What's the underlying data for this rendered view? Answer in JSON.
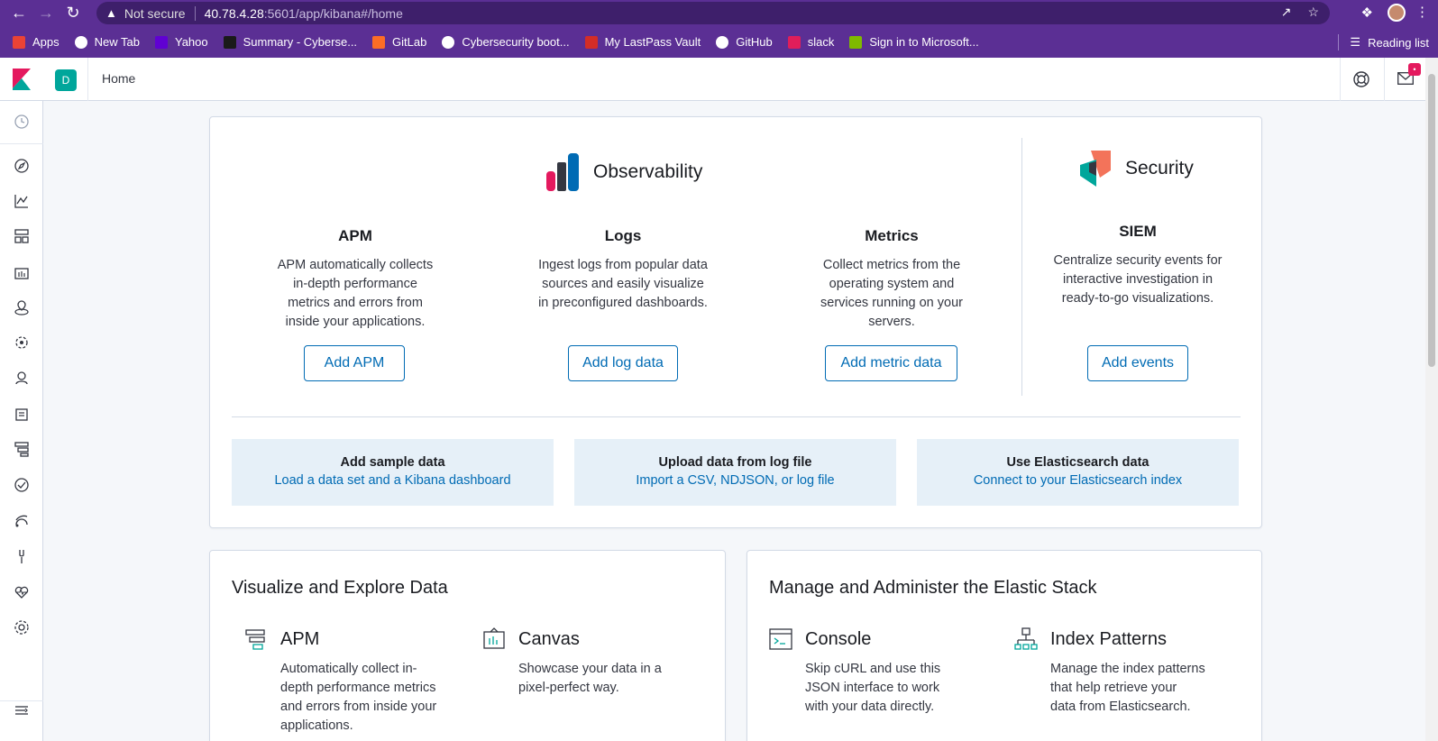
{
  "browser": {
    "not_secure": "Not secure",
    "url_host": "40.78.4.28",
    "url_rest": ":5601/app/kibana#/home",
    "bookmarks": [
      {
        "label": "Apps",
        "color": "#ea4335"
      },
      {
        "label": "New Tab",
        "color": "#ffffff"
      },
      {
        "label": "Yahoo",
        "color": "#6001d2"
      },
      {
        "label": "Summary - Cyberse...",
        "color": "#1a1a1a"
      },
      {
        "label": "GitLab",
        "color": "#fc6d26"
      },
      {
        "label": "Cybersecurity boot...",
        "color": "#ffffff"
      },
      {
        "label": "My LastPass Vault",
        "color": "#d32d27"
      },
      {
        "label": "GitHub",
        "color": "#ffffff"
      },
      {
        "label": "slack",
        "color": "#e01e5a"
      },
      {
        "label": "Sign in to Microsoft...",
        "color": "#7fba00"
      }
    ],
    "reading_list": "Reading list"
  },
  "header": {
    "space_initial": "D",
    "breadcrumb": "Home",
    "news_badge": "•"
  },
  "sidenav_icons": [
    "recently-viewed-icon",
    "discover-icon",
    "visualize-icon",
    "dashboard-icon",
    "canvas-icon",
    "maps-icon",
    "machine-learning-icon",
    "infrastructure-icon",
    "logs-icon",
    "apm-icon",
    "uptime-icon",
    "siem-icon",
    "dev-tools-icon",
    "monitoring-icon",
    "management-icon",
    "collapse-icon"
  ],
  "observability": {
    "title": "Observability",
    "items": [
      {
        "title": "APM",
        "desc": [
          "APM automatically collects",
          "in-depth performance",
          "metrics and errors from",
          "inside your applications."
        ],
        "button": "Add APM"
      },
      {
        "title": "Logs",
        "desc": [
          "Ingest logs from popular data",
          "sources and easily visualize",
          "in preconfigured dashboards."
        ],
        "button": "Add log data"
      },
      {
        "title": "Metrics",
        "desc": [
          "Collect metrics from the",
          "operating system and",
          "services running on your",
          "servers."
        ],
        "button": "Add metric data"
      }
    ]
  },
  "security": {
    "title": "Security",
    "item": {
      "title": "SIEM",
      "desc": [
        "Centralize security events for",
        "interactive investigation in",
        "ready-to-go visualizations."
      ],
      "button": "Add events"
    }
  },
  "tiles": [
    {
      "title": "Add sample data",
      "link": "Load a data set and a Kibana dashboard"
    },
    {
      "title": "Upload data from log file",
      "link": "Import a CSV, NDJSON, or log file"
    },
    {
      "title": "Use Elasticsearch data",
      "link": "Connect to your Elasticsearch index"
    }
  ],
  "visualize": {
    "title": "Visualize and Explore Data",
    "apps": [
      {
        "name": "APM",
        "desc": [
          "Automatically collect in-",
          "depth performance metrics",
          "and errors from inside your",
          "applications."
        ]
      },
      {
        "name": "Canvas",
        "desc": [
          "Showcase your data in a",
          "pixel-perfect way."
        ]
      }
    ]
  },
  "manage": {
    "title": "Manage and Administer the Elastic Stack",
    "apps": [
      {
        "name": "Console",
        "desc": [
          "Skip cURL and use this",
          "JSON interface to work",
          "with your data directly."
        ]
      },
      {
        "name": "Index Patterns",
        "desc": [
          "Manage the index patterns",
          "that help retrieve your",
          "data from Elasticsearch."
        ]
      }
    ]
  },
  "colors": {
    "accent": "#006bb4",
    "chrome": "#5b2f94",
    "tile_bg": "#e6f0f8",
    "kibana_teal": "#00a69b",
    "kibana_pink": "#e4195e"
  }
}
